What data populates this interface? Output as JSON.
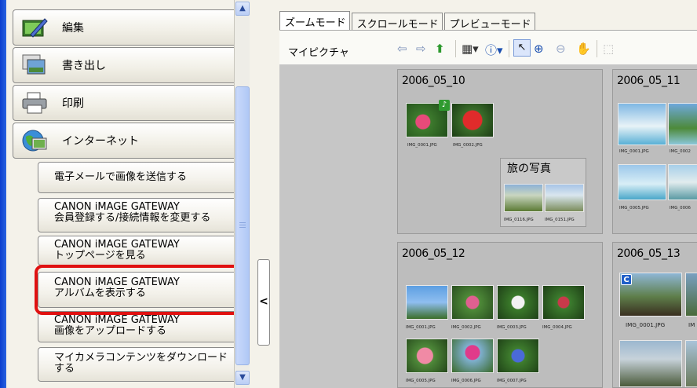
{
  "sidebar": {
    "categories": [
      {
        "label": "編集",
        "icon": "edit-palette-icon"
      },
      {
        "label": "書き出し",
        "icon": "export-photos-icon"
      },
      {
        "label": "印刷",
        "icon": "printer-icon"
      },
      {
        "label": "インターネット",
        "icon": "internet-globe-icon"
      }
    ],
    "tasks": [
      {
        "lines": [
          "電子メールで画像を送信する"
        ]
      },
      {
        "lines": [
          "CANON iMAGE GATEWAY",
          "会員登録する/接続情報を変更する"
        ]
      },
      {
        "lines": [
          "CANON iMAGE GATEWAY",
          "トップページを見る"
        ]
      },
      {
        "lines": [
          "CANON iMAGE GATEWAY",
          "アルバムを表示する"
        ]
      },
      {
        "lines": [
          "CANON iMAGE GATEWAY",
          "画像をアップロードする"
        ]
      },
      {
        "lines": [
          "マイカメラコンテンツをダウンロード",
          "する"
        ]
      }
    ],
    "collapse_glyph": "<"
  },
  "tabs": [
    "ズームモード",
    "スクロールモード",
    "プレビューモード"
  ],
  "toolbar": {
    "location": "マイピクチャ"
  },
  "folders": [
    {
      "date": "2006_05_10",
      "captions": [
        "IMG_0001.JPG",
        "IMG_0002.JPG"
      ],
      "subfolder": {
        "title": "旅の写真",
        "captions": [
          "IMG_0116.JPG",
          "IMG_0151.JPG"
        ]
      },
      "badge": "♪"
    },
    {
      "date": "2006_05_11",
      "captions": [
        "IMG_0001.JPG",
        "IMG_0002",
        "IMG_0005.JPG",
        "IMG_0006"
      ]
    },
    {
      "date": "2006_05_12",
      "captions": [
        "IMG_0001.JPG",
        "IMG_0002.JPG",
        "IMG_0003.JPG",
        "IMG_0004.JPG",
        "IMG_0005.JPG",
        "IMG_0006.JPG",
        "IMG_0007.JPG"
      ]
    },
    {
      "date": "2006_05_13",
      "captions": [
        "IMG_0001.JPG",
        "IM"
      ],
      "badge": "C"
    }
  ],
  "colors": {
    "highlight": "#e01111",
    "accent_bar": "#0b3ecf"
  }
}
